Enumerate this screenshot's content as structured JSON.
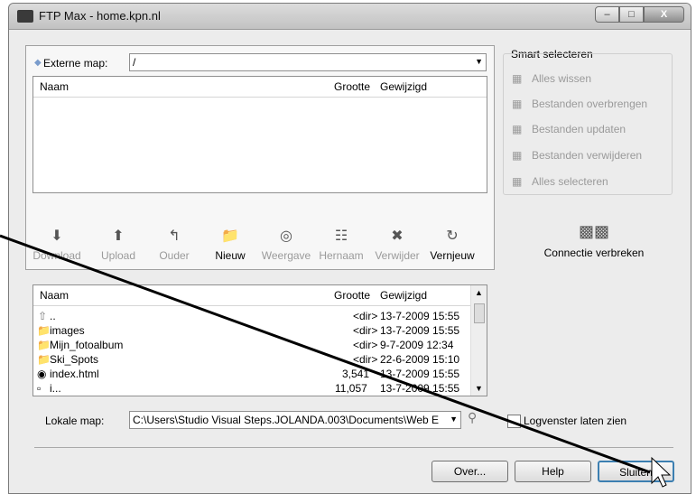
{
  "window": {
    "title": "FTP Max - home.kpn.nl",
    "controls": [
      "minimize",
      "maximize",
      "close"
    ]
  },
  "remote": {
    "label": "Externe map:",
    "path": "/",
    "columns": {
      "name": "Naam",
      "size": "Grootte",
      "modified": "Gewijzigd"
    },
    "files": []
  },
  "toolbar": {
    "download": "Download",
    "upload": "Upload",
    "up": "Ouder",
    "new": "Nieuw",
    "view": "Weergave",
    "rename": "Hernaam",
    "delete": "Verwijder",
    "refresh": "Vernjeuw"
  },
  "smart": {
    "title": "Smart selecteren",
    "items": [
      "Alles wissen",
      "Bestanden overbrengen",
      "Bestanden updaten",
      "Bestanden verwijderen",
      "Alles selecteren"
    ]
  },
  "connection": {
    "disconnect": "Connectie verbreken"
  },
  "local": {
    "columns": {
      "name": "Naam",
      "size": "Grootte",
      "modified": "Gewijzigd"
    },
    "files": [
      {
        "name": "..",
        "size": "<dir>",
        "modified": "13-7-2009 15:55"
      },
      {
        "name": "images",
        "size": "<dir>",
        "modified": "13-7-2009 15:55"
      },
      {
        "name": "Mijn_fotoalbum",
        "size": "<dir>",
        "modified": "9-7-2009 12:34"
      },
      {
        "name": "Ski_Spots",
        "size": "<dir>",
        "modified": "22-6-2009 15:10"
      },
      {
        "name": "index.html",
        "size": "3,541",
        "modified": "13-7-2009 15:55"
      },
      {
        "name": "i...",
        "size": "11,057",
        "modified": "13-7-2009 15:55"
      }
    ],
    "map_label": "Lokale map:",
    "map_path": "C:\\Users\\Studio Visual Steps.JOLANDA.003\\Documents\\Web E..."
  },
  "log": {
    "label": "Logvenster laten zien"
  },
  "buttons": {
    "about": "Over...",
    "help": "Help",
    "close": "Sluiten"
  }
}
